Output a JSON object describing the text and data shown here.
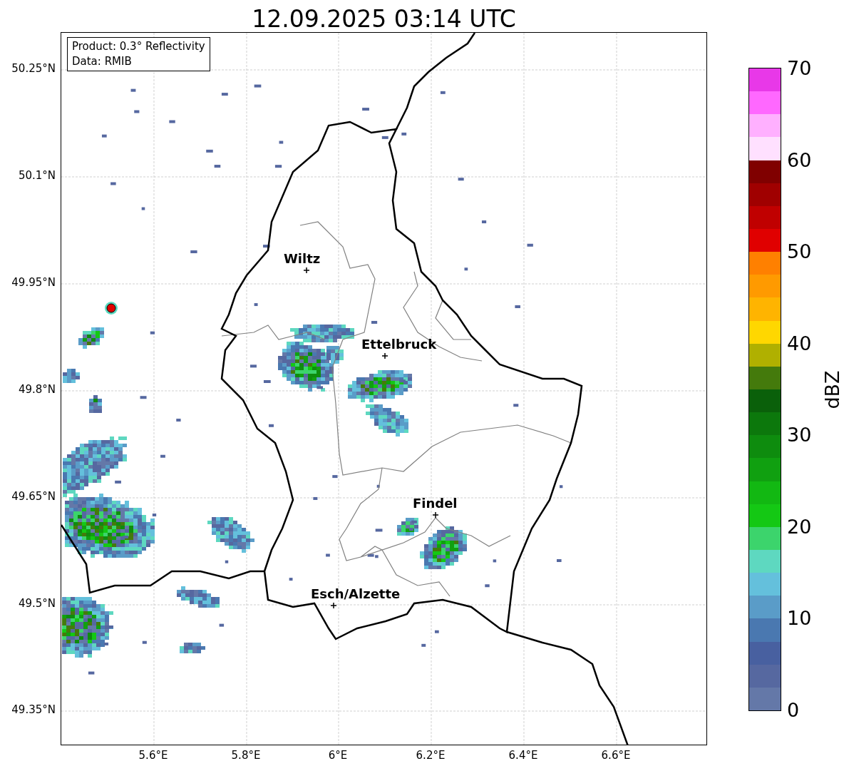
{
  "title": "12.09.2025 03:14 UTC",
  "info_box": [
    "Product: 0.3° Reflectivity",
    "Data: RMIB"
  ],
  "map": {
    "x_ticks": [
      "5.6°E",
      "5.8°E",
      "6°E",
      "6.2°E",
      "6.4°E",
      "6.6°E"
    ],
    "y_ticks": [
      "50.25°N",
      "50.1°N",
      "49.95°N",
      "49.8°N",
      "49.65°N",
      "49.5°N",
      "49.35°N"
    ],
    "places": [
      {
        "name": "Wiltz"
      },
      {
        "name": "Ettelbruck"
      },
      {
        "name": "Findel"
      },
      {
        "name": "Esch/Alzette"
      }
    ]
  },
  "colorbar": {
    "label": "dBZ",
    "ticks": [
      "70",
      "60",
      "50",
      "40",
      "30",
      "20",
      "10",
      "0"
    ],
    "segments": [
      {
        "color": "#e838e8"
      },
      {
        "color": "#ff68ff"
      },
      {
        "color": "#ffb0ff"
      },
      {
        "color": "#ffe0ff"
      },
      {
        "color": "#800000"
      },
      {
        "color": "#a00000"
      },
      {
        "color": "#c00000"
      },
      {
        "color": "#e00000"
      },
      {
        "color": "#ff8000"
      },
      {
        "color": "#ff9a00"
      },
      {
        "color": "#ffb400"
      },
      {
        "color": "#ffd700"
      },
      {
        "color": "#b0b000"
      },
      {
        "color": "#447a0c"
      },
      {
        "color": "#0a600a"
      },
      {
        "color": "#0c780c"
      },
      {
        "color": "#0e8c0e"
      },
      {
        "color": "#10a010"
      },
      {
        "color": "#12b812"
      },
      {
        "color": "#14c814"
      },
      {
        "color": "#3cd46c"
      },
      {
        "color": "#5ed8c0"
      },
      {
        "color": "#64c0dc"
      },
      {
        "color": "#5a9cc8"
      },
      {
        "color": "#4a78b0"
      },
      {
        "color": "#4860a0"
      },
      {
        "color": "#5668a0"
      },
      {
        "color": "#6478a8"
      }
    ]
  }
}
